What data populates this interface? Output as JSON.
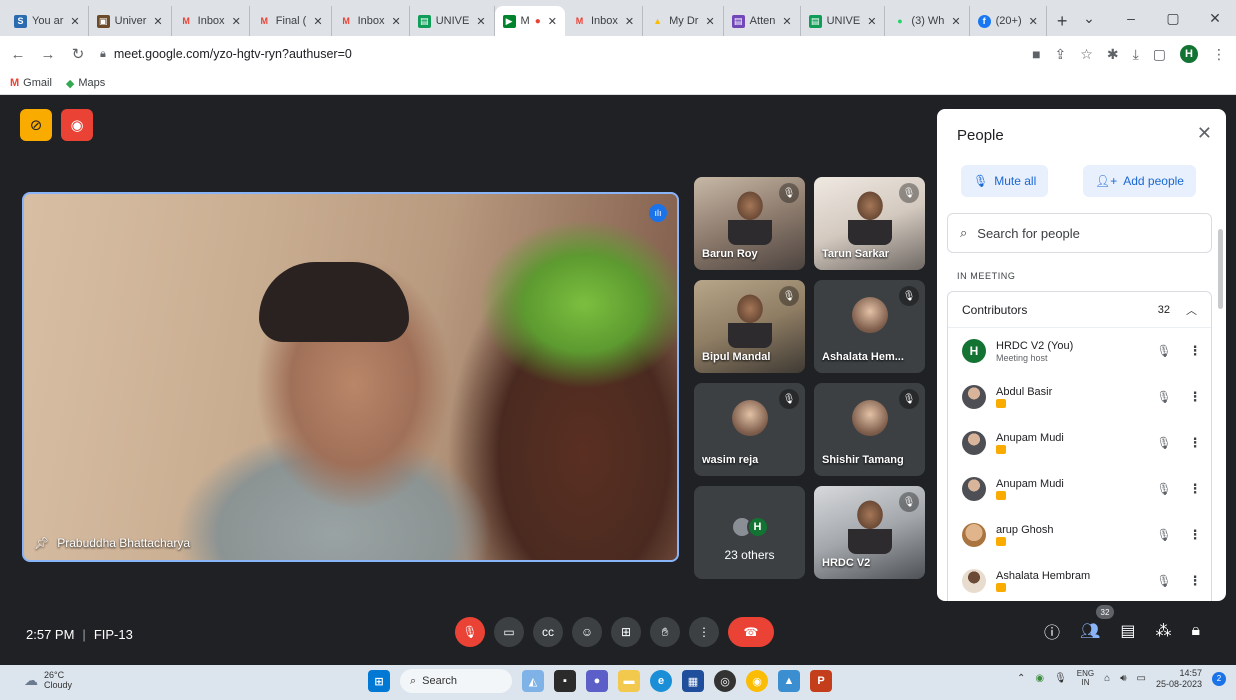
{
  "browser": {
    "tabs": [
      {
        "label": "You ar",
        "color": "#2b6cb0",
        "glyph": "S"
      },
      {
        "label": "Univer",
        "color": "#6b4b2a",
        "glyph": "▣"
      },
      {
        "label": "Inbox",
        "color": "#ffffff",
        "glyph": "M"
      },
      {
        "label": "Final (",
        "color": "#ffffff",
        "glyph": "M"
      },
      {
        "label": "Inbox",
        "color": "#ffffff",
        "glyph": "M"
      },
      {
        "label": "UNIVE",
        "color": "#0f9d58",
        "glyph": "▤"
      },
      {
        "label": "M",
        "color": "#00832d",
        "glyph": "▶",
        "active": true
      },
      {
        "label": "Inbox",
        "color": "#ffffff",
        "glyph": "M"
      },
      {
        "label": "My Dr",
        "color": "#fbbc04",
        "glyph": "▲"
      },
      {
        "label": "Atten",
        "color": "#7248b9",
        "glyph": "▤"
      },
      {
        "label": "UNIVE",
        "color": "#0f9d58",
        "glyph": "▤"
      },
      {
        "label": "(3) Wh",
        "color": "#25d366",
        "glyph": "●"
      },
      {
        "label": "(20+)",
        "color": "#1877f2",
        "glyph": "f"
      }
    ],
    "url": "meet.google.com/yzo-hgtv-ryn?authuser=0",
    "profile_initial": "H",
    "bookmarks": [
      {
        "label": "Gmail",
        "icon": "gmail-icon"
      },
      {
        "label": "Maps",
        "icon": "maps-icon"
      }
    ]
  },
  "meeting": {
    "main_speaker": "Prabuddha Bhattacharya",
    "tiles": [
      {
        "name": "Barun Roy"
      },
      {
        "name": "Tarun Sarkar"
      },
      {
        "name": "Bipul Mandal"
      },
      {
        "name": "Ashalata Hem..."
      },
      {
        "name": "wasim reja"
      },
      {
        "name": "Shishir Tamang"
      },
      {
        "name": "23 others",
        "avatar_initial": "H"
      },
      {
        "name": "HRDC V2"
      }
    ],
    "time": "2:57 PM",
    "code": "FIP-13",
    "people_count_badge": "32"
  },
  "people_panel": {
    "title": "People",
    "mute_all": "Mute all",
    "add_people": "Add people",
    "search_placeholder": "Search for people",
    "section_label": "IN MEETING",
    "group_label": "Contributors",
    "group_count": "32",
    "participants": [
      {
        "name": "HRDC V2 (You)",
        "sub": "Meeting host",
        "initial": "H"
      },
      {
        "name": "Abdul Basir"
      },
      {
        "name": "Anupam Mudi"
      },
      {
        "name": "Anupam Mudi"
      },
      {
        "name": "arup Ghosh"
      },
      {
        "name": "Ashalata Hembram"
      }
    ]
  },
  "taskbar": {
    "weather_temp": "26°C",
    "weather_desc": "Cloudy",
    "search_label": "Search",
    "lang_top": "ENG",
    "lang_bottom": "IN",
    "time": "14:57",
    "date": "25-08-2023",
    "notification_count": "2"
  }
}
